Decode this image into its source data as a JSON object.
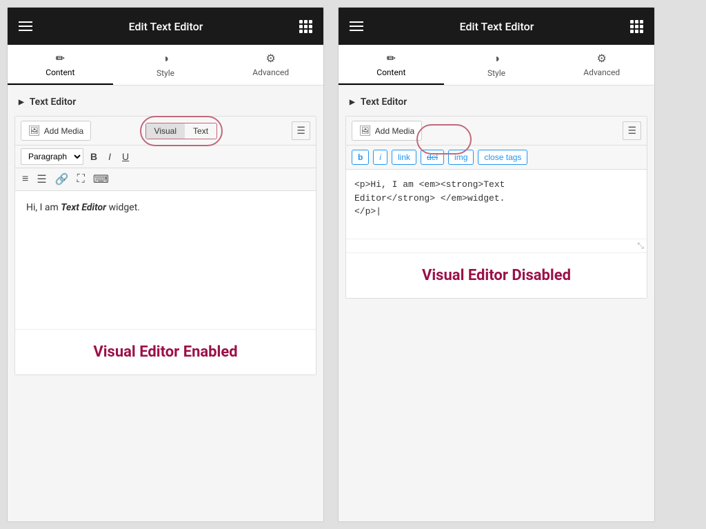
{
  "left_panel": {
    "header_title": "Edit Text Editor",
    "tabs": [
      {
        "label": "Content",
        "icon": "✏️",
        "active": true
      },
      {
        "label": "Style",
        "icon": "◑",
        "active": false
      },
      {
        "label": "Advanced",
        "icon": "⚙",
        "active": false
      }
    ],
    "section_title": "Text Editor",
    "add_media_label": "Add Media",
    "visual_btn": "Visual",
    "text_btn": "Text",
    "paragraph_label": "Paragraph",
    "bold_label": "B",
    "italic_label": "I",
    "underline_label": "U",
    "editor_text": "Hi, I am ",
    "editor_text_bold_italic": "Text Editor",
    "editor_text_after": " widget.",
    "caption": "Visual Editor Enabled"
  },
  "right_panel": {
    "header_title": "Edit Text Editor",
    "tabs": [
      {
        "label": "Content",
        "icon": "✏️",
        "active": true
      },
      {
        "label": "Style",
        "icon": "◑",
        "active": false
      },
      {
        "label": "Advanced",
        "icon": "⚙",
        "active": false
      }
    ],
    "section_title": "Text Editor",
    "add_media_label": "Add Media",
    "html_tags": [
      "b",
      "i",
      "link",
      "del",
      "img",
      "close tags"
    ],
    "code_content": "<p>Hi, I am <em><strong>Text\nEditor</strong> </em>widget.\n</p>|",
    "caption": "Visual Editor Disabled"
  }
}
